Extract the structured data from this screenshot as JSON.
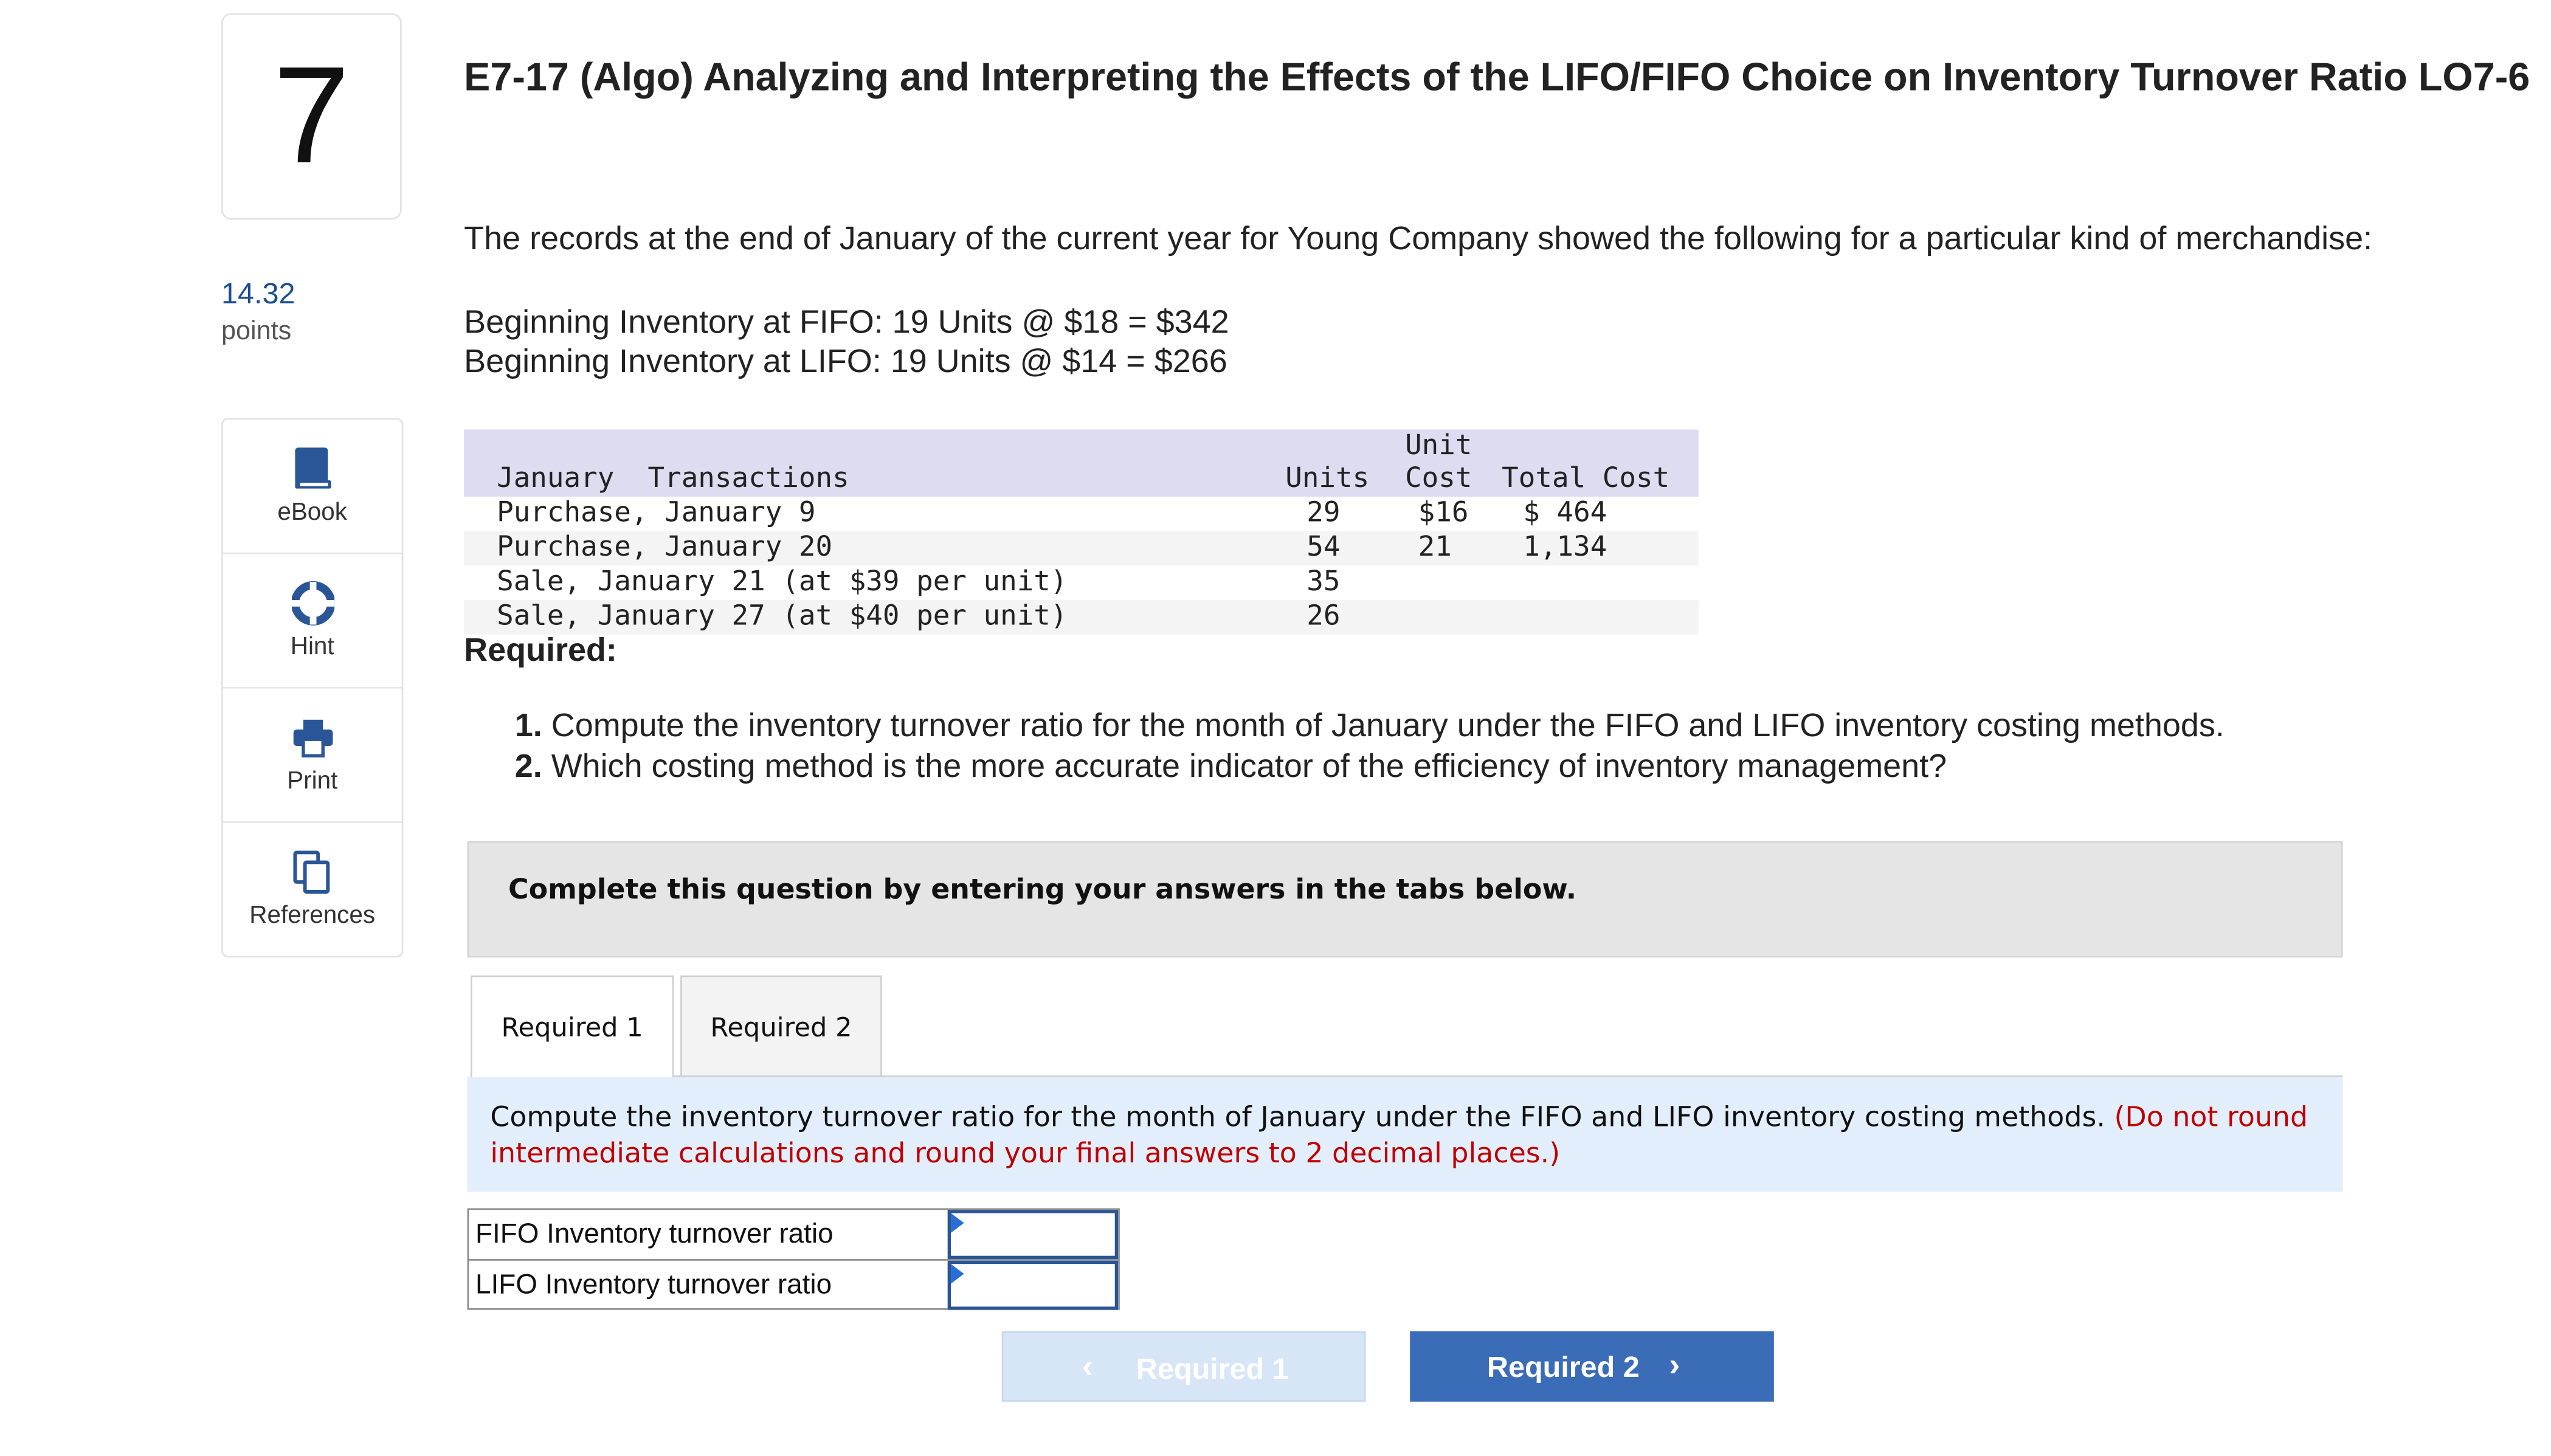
{
  "question": {
    "number": "7",
    "points_value": "14.32",
    "points_label": "points"
  },
  "sidebar": {
    "items": [
      {
        "label": "eBook",
        "icon": "book-icon"
      },
      {
        "label": "Hint",
        "icon": "lifebuoy-icon"
      },
      {
        "label": "Print",
        "icon": "printer-icon"
      },
      {
        "label": "References",
        "icon": "copy-icon"
      }
    ]
  },
  "title": "E7-17 (Algo) Analyzing and Interpreting the Effects of the LIFO/FIFO Choice on Inventory Turnover Ratio LO7-6",
  "intro": "The records at the end of January of the current year for Young Company showed the following for a particular kind of merchandise:",
  "beginning": {
    "fifo": "Beginning Inventory at FIFO: 19 Units @ $18 = $342",
    "lifo": "Beginning Inventory at LIFO: 19 Units @ $14 = $266"
  },
  "transactions": {
    "header": {
      "description": "January  Transactions",
      "units": "Units",
      "unit_top": "Unit",
      "unit_cost": "Cost",
      "total_cost": "Total Cost"
    },
    "rows": [
      {
        "description": "Purchase, January 9",
        "units": "29",
        "unit_cost": "$16",
        "total_cost": "$ 464"
      },
      {
        "description": "Purchase, January 20",
        "units": "54",
        "unit_cost": "21",
        "total_cost": "1,134"
      },
      {
        "description": "Sale, January 21 (at $39 per unit)",
        "units": "35",
        "unit_cost": "",
        "total_cost": ""
      },
      {
        "description": "Sale, January 27 (at $40 per unit)",
        "units": "26",
        "unit_cost": "",
        "total_cost": ""
      }
    ]
  },
  "required": {
    "label": "Required:",
    "items": [
      {
        "num": "1.",
        "text": "Compute the inventory turnover ratio for the month of January under the FIFO and LIFO inventory costing methods."
      },
      {
        "num": "2.",
        "text": "Which costing method is the more accurate indicator of the efficiency of inventory management?"
      }
    ]
  },
  "complete_banner": "Complete this question by entering your answers in the tabs below.",
  "tabs": [
    {
      "label": "Required 1",
      "active": true
    },
    {
      "label": "Required 2",
      "active": false
    }
  ],
  "instructions": {
    "main": "Compute the inventory turnover ratio for the month of January under the FIFO and LIFO inventory costing methods.",
    "note": "(Do not round intermediate calculations and round your final answers to 2 decimal places.)"
  },
  "answers": [
    {
      "label": "FIFO Inventory turnover ratio",
      "value": ""
    },
    {
      "label": "LIFO Inventory turnover ratio",
      "value": ""
    }
  ],
  "nav": {
    "prev_label": "Required 1",
    "next_label": "Required 2",
    "prev_icon": "chevron-left-icon",
    "next_icon": "chevron-right-icon"
  },
  "colors": {
    "accent": "#3a6cb8",
    "points": "#1a4d8f",
    "note_red": "#c00000",
    "table_header": "#dedcf0",
    "instructions_bg": "#e2eefb",
    "icon_blue": "#2a5596"
  }
}
